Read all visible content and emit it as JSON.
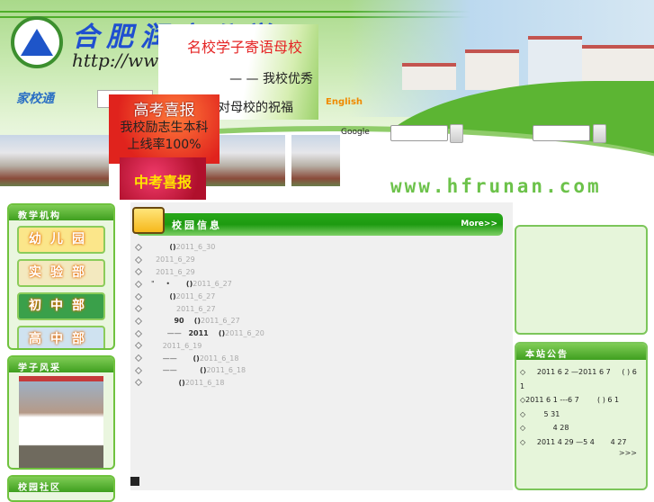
{
  "header": {
    "site_name": "合肥润安公学",
    "site_url": "http://www.hfrunan.com",
    "jiaxiaotong": "家校通",
    "english_link": "English",
    "google_label": "Google",
    "domain_text": "www.hfrunan.com"
  },
  "popups": {
    "alumni": {
      "line1": "名校学子寄语母校",
      "line2": "— — 我校优秀",
      "line3": "毕业生对母校的祝福"
    },
    "gaokao": {
      "title": "高考喜报",
      "line1": "我校励志生本科",
      "line2": "上线率100%"
    },
    "zhongkao": {
      "title": "中考喜报"
    }
  },
  "left": {
    "departments_title": "教学机构",
    "departments": [
      {
        "label": "幼儿园",
        "color": "#fbe68a"
      },
      {
        "label": "实验部",
        "color": "#f6efc8"
      },
      {
        "label": "初中部",
        "color": "#3aa04a"
      },
      {
        "label": "高中部",
        "color": "#cfe2f0"
      }
    ],
    "students_title": "学子风采",
    "community_title": "校园社区"
  },
  "campus_news": {
    "title": "校园信息",
    "more": "More>>",
    "items": [
      {
        "pre": "        ",
        "bold": "",
        "paren": "()",
        "date": "2011_6_30"
      },
      {
        "pre": "  ",
        "bold": "",
        "paren": "",
        "date": "2011_6_29"
      },
      {
        "pre": "  ",
        "bold": "",
        "paren": "",
        "date": "2011_6_29"
      },
      {
        "pre": "\"     •       ",
        "bold": "",
        "paren": "()",
        "date": "2011_6_27"
      },
      {
        "pre": "        ",
        "bold": "",
        "paren": "()",
        "date": "2011_6_27"
      },
      {
        "pre": "           ",
        "bold": "",
        "paren": "",
        "date": "2011_6_27"
      },
      {
        "pre": "          ",
        "bold": "90",
        "paren": "    ()",
        "date": "2011_6_27"
      },
      {
        "pre": "       ——   ",
        "bold": "2011",
        "paren": "    ()",
        "date": "2011_6_20"
      },
      {
        "pre": "     ",
        "bold": "",
        "paren": "",
        "date": "2011_6_19"
      },
      {
        "pre": "     ——       ",
        "bold": "",
        "paren": "()",
        "date": "2011_6_18"
      },
      {
        "pre": "     ——          ",
        "bold": "",
        "paren": "()",
        "date": "2011_6_18"
      },
      {
        "pre": "            ",
        "bold": "",
        "paren": "()",
        "date": "2011_6_18"
      }
    ]
  },
  "notices": {
    "title": "本站公告",
    "items": [
      "◇     2011 6 2 —2011 6 7     ( ) 6 1",
      "◇2011 6 1 ---6 7        ( ) 6 1",
      "◇        5 31",
      "◇            4 28",
      "◇     2011 4 29 —5 4       4 27"
    ],
    "more": ">>>"
  }
}
